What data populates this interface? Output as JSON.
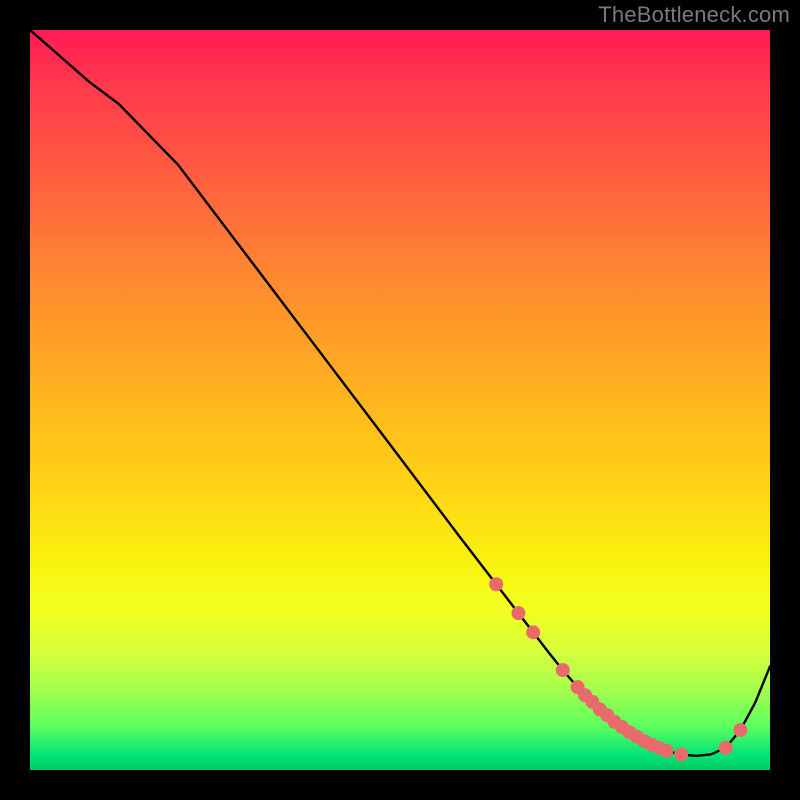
{
  "watermark": "TheBottleneck.com",
  "chart_data": {
    "type": "line",
    "title": "",
    "xlabel": "",
    "ylabel": "",
    "xlim": [
      0,
      100
    ],
    "ylim": [
      0,
      100
    ],
    "grid": false,
    "legend": false,
    "series": [
      {
        "name": "curve",
        "color": "#000000",
        "x": [
          0,
          4,
          8,
          12,
          20,
          30,
          40,
          50,
          58,
          63,
          66,
          68,
          70,
          72,
          74,
          76,
          78,
          80,
          82,
          84,
          86,
          88,
          90,
          92,
          94,
          96,
          98,
          100
        ],
        "y": [
          100,
          96.5,
          93,
          90,
          81.8,
          68.6,
          55.4,
          42.2,
          31.6,
          25.1,
          21.2,
          18.6,
          16.0,
          13.5,
          11.2,
          9.2,
          7.4,
          5.8,
          4.5,
          3.4,
          2.6,
          2.1,
          1.9,
          2.1,
          3.0,
          5.4,
          9.1,
          14.0
        ]
      }
    ],
    "markers": [
      {
        "name": "points-on-curve",
        "color": "#e86a6a",
        "x": [
          63,
          66,
          68,
          72,
          74,
          75,
          76,
          77,
          78,
          79,
          80,
          81,
          82,
          83,
          84,
          85,
          86,
          88,
          94,
          96
        ],
        "y": [
          25.1,
          21.2,
          18.6,
          13.5,
          11.2,
          10.1,
          9.2,
          8.2,
          7.4,
          6.5,
          5.8,
          5.1,
          4.5,
          3.9,
          3.4,
          3.0,
          2.6,
          2.1,
          3.0,
          5.4
        ]
      }
    ],
    "background": {
      "type": "vertical-gradient",
      "stops": [
        {
          "pos": 0.0,
          "color": "#ff1a55"
        },
        {
          "pos": 0.2,
          "color": "#ff5f40"
        },
        {
          "pos": 0.48,
          "color": "#ffb020"
        },
        {
          "pos": 0.72,
          "color": "#f8f30e"
        },
        {
          "pos": 0.89,
          "color": "#a6ff4d"
        },
        {
          "pos": 1.0,
          "color": "#00c864"
        }
      ]
    }
  }
}
